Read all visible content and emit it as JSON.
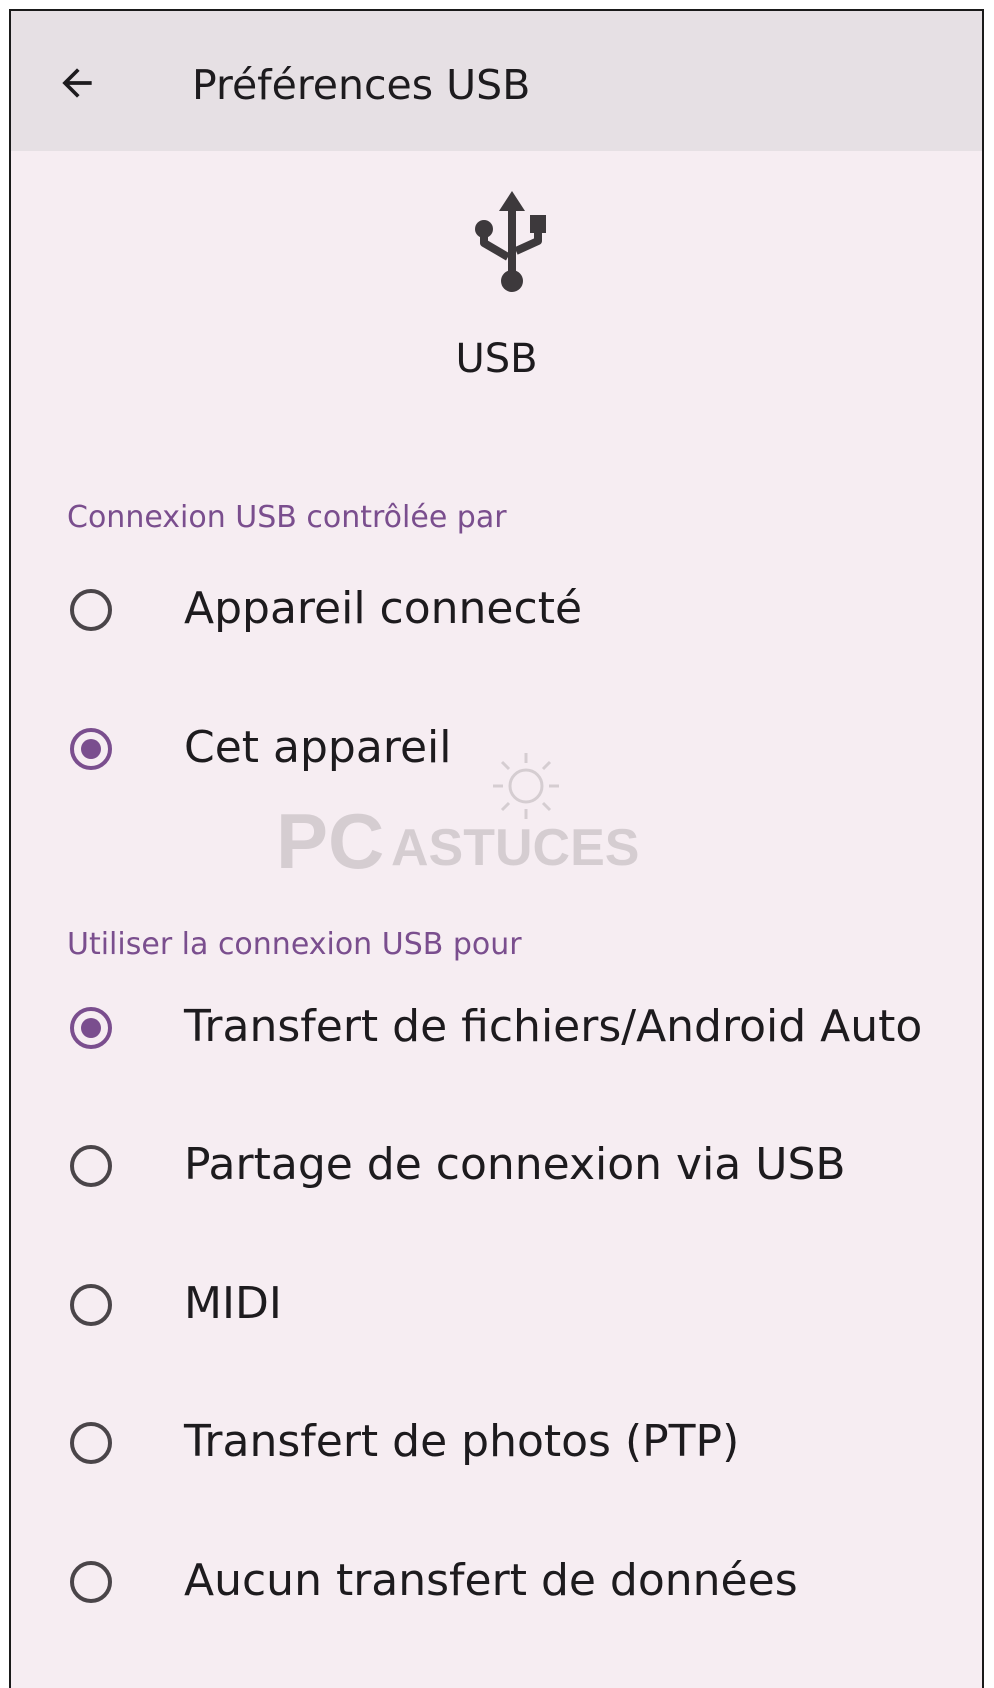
{
  "appbar": {
    "title": "Préférences USB",
    "back_icon": "arrow-back-icon"
  },
  "header": {
    "icon": "usb-icon",
    "label": "USB"
  },
  "section_control": {
    "title": "Connexion USB contrôlée par",
    "options": [
      {
        "label": "Appareil connecté",
        "selected": false
      },
      {
        "label": "Cet appareil",
        "selected": true
      }
    ]
  },
  "section_use": {
    "title": "Utiliser la connexion USB pour",
    "options": [
      {
        "label": "Transfert de fichiers/Android Auto",
        "selected": true
      },
      {
        "label": "Partage de connexion via USB",
        "selected": false
      },
      {
        "label": "MIDI",
        "selected": false
      },
      {
        "label": "Transfert de photos (PTP)",
        "selected": false
      },
      {
        "label": "Aucun transfert de données",
        "selected": false
      }
    ]
  },
  "watermark": {
    "brand_main": "PC",
    "brand_sub": "ASTUCES"
  },
  "colors": {
    "accent": "#7a4e8e",
    "background": "#f6edf2",
    "appbar": "#e6e0e4",
    "text": "#1d1b1e"
  }
}
